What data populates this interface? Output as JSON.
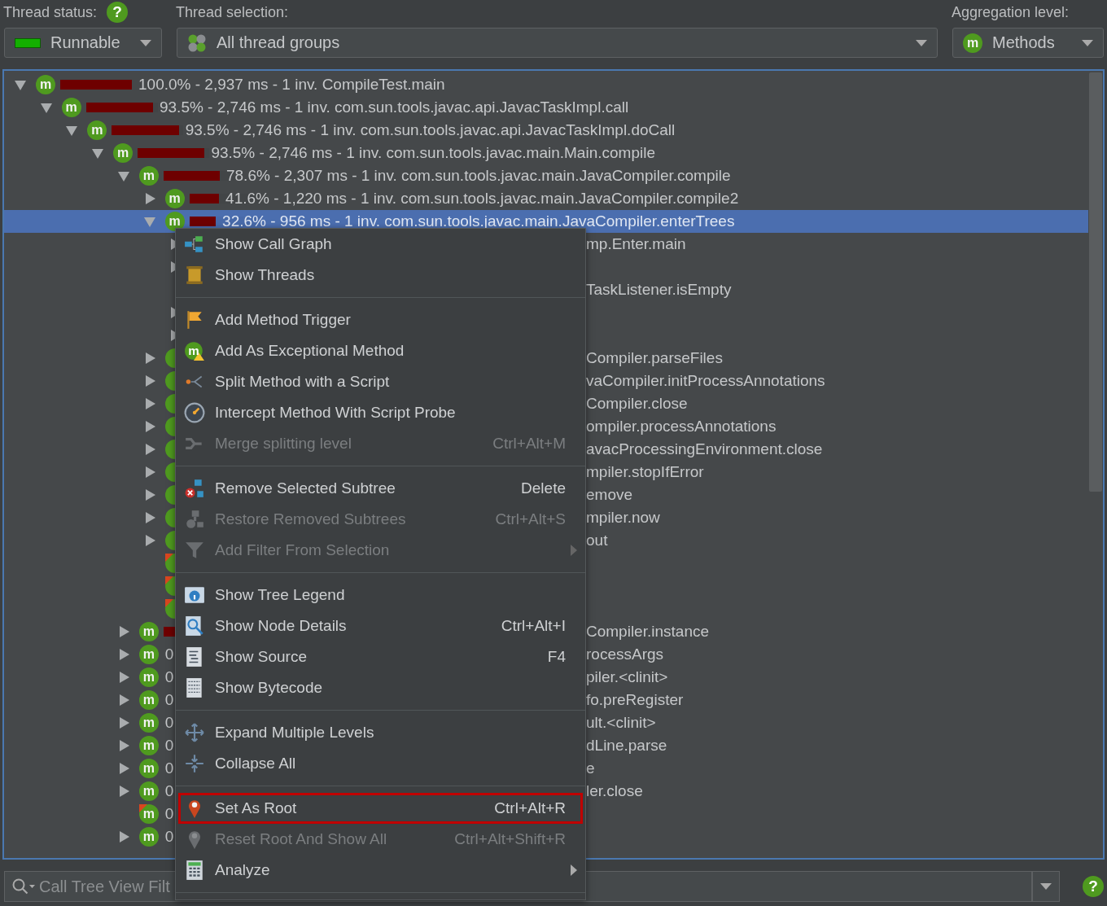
{
  "thread_status": {
    "label": "Thread status:",
    "help": "?",
    "value": "Runnable"
  },
  "thread_selection": {
    "label": "Thread selection:",
    "value": "All thread groups"
  },
  "aggregation_level": {
    "label": "Aggregation level:",
    "value": "Methods",
    "icon": "m"
  },
  "call_tree": [
    {
      "kind": "node",
      "expanded": true,
      "selected": false,
      "icon": "m",
      "level": 1.0,
      "label": "100.0% - 2,937 ms - 1 inv. CompileTest.main",
      "children": [
        {
          "kind": "node",
          "expanded": true,
          "selected": false,
          "icon": "m",
          "level": 0.935,
          "label": "93.5% - 2,746 ms - 1 inv. com.sun.tools.javac.api.JavacTaskImpl.call",
          "children": [
            {
              "kind": "node",
              "expanded": true,
              "selected": false,
              "icon": "m",
              "level": 0.935,
              "label": "93.5% - 2,746 ms - 1 inv. com.sun.tools.javac.api.JavacTaskImpl.doCall",
              "children": [
                {
                  "kind": "node",
                  "expanded": true,
                  "selected": false,
                  "icon": "m",
                  "level": 0.935,
                  "label": "93.5% - 2,746 ms - 1 inv. com.sun.tools.javac.main.Main.compile",
                  "children": [
                    {
                      "kind": "node",
                      "expanded": true,
                      "selected": false,
                      "icon": "m",
                      "level": 0.786,
                      "label": "78.6% - 2,307 ms - 1 inv. com.sun.tools.javac.main.JavaCompiler.compile",
                      "children": [
                        {
                          "kind": "node",
                          "expanded": false,
                          "selected": false,
                          "icon": "m",
                          "level": 0.416,
                          "label": "41.6% - 1,220 ms - 1 inv. com.sun.tools.javac.main.JavaCompiler.compile2"
                        },
                        {
                          "kind": "node",
                          "expanded": true,
                          "selected": true,
                          "icon": "m",
                          "level": 0.37,
                          "label": "32.6% - 956 ms - 1 inv. com.sun.tools.javac.main.JavaCompiler.enterTrees",
                          "children": [
                            {
                              "kind": "node",
                              "expanded": false,
                              "selected": false,
                              "tail": "mp.Enter.main"
                            },
                            {
                              "kind": "node",
                              "expanded": false,
                              "selected": false
                            },
                            {
                              "kind": "leaf",
                              "selected": false,
                              "tail": "TaskListener.isEmpty"
                            },
                            {
                              "kind": "node",
                              "expanded": false,
                              "selected": false
                            },
                            {
                              "kind": "node",
                              "expanded": false,
                              "selected": false
                            }
                          ]
                        },
                        {
                          "kind": "node",
                          "expanded": false,
                          "selected": false,
                          "method_icon": true,
                          "tail": "Compiler.parseFiles"
                        },
                        {
                          "kind": "node",
                          "expanded": false,
                          "selected": false,
                          "method_icon": true,
                          "tail": "vaCompiler.initProcessAnnotations"
                        },
                        {
                          "kind": "node",
                          "expanded": false,
                          "selected": false,
                          "method_icon": true,
                          "tail": "Compiler.close"
                        },
                        {
                          "kind": "node",
                          "expanded": false,
                          "selected": false,
                          "method_icon": true,
                          "tail": "ompiler.processAnnotations"
                        },
                        {
                          "kind": "node",
                          "expanded": false,
                          "selected": false,
                          "method_icon": true,
                          "tail": "avacProcessingEnvironment.close"
                        },
                        {
                          "kind": "node",
                          "expanded": false,
                          "selected": false,
                          "method_icon": true,
                          "tail": "mpiler.stopIfError"
                        },
                        {
                          "kind": "node",
                          "expanded": false,
                          "selected": false,
                          "method_icon": true,
                          "tail": "emove"
                        },
                        {
                          "kind": "node",
                          "expanded": false,
                          "selected": false,
                          "method_icon": true,
                          "tail": "mpiler.now"
                        },
                        {
                          "kind": "node",
                          "expanded": false,
                          "selected": false,
                          "method_icon": true,
                          "tail": "out"
                        },
                        {
                          "kind": "leaf",
                          "selected": false,
                          "method_icon": true,
                          "flagged": true
                        },
                        {
                          "kind": "leaf",
                          "selected": false,
                          "method_icon": true,
                          "flagged": true
                        },
                        {
                          "kind": "leaf",
                          "selected": false,
                          "method_icon": true,
                          "flagged": true
                        }
                      ]
                    },
                    {
                      "kind": "node",
                      "expanded": false,
                      "selected": false,
                      "icon": "m",
                      "level": 0.2,
                      "tail": "Compiler.instance"
                    },
                    {
                      "kind": "node",
                      "expanded": false,
                      "selected": false,
                      "icon": "m",
                      "head": "0",
                      "tail": "rocessArgs"
                    },
                    {
                      "kind": "node",
                      "expanded": false,
                      "selected": false,
                      "icon": "m",
                      "head": "0",
                      "tail": "piler.<clinit>"
                    },
                    {
                      "kind": "node",
                      "expanded": false,
                      "selected": false,
                      "icon": "m",
                      "head": "0",
                      "tail": "fo.preRegister"
                    },
                    {
                      "kind": "node",
                      "expanded": false,
                      "selected": false,
                      "icon": "m",
                      "head": "0",
                      "tail": "ult.<clinit>"
                    },
                    {
                      "kind": "node",
                      "expanded": false,
                      "selected": false,
                      "icon": "m",
                      "head": "0",
                      "tail": "dLine.parse"
                    },
                    {
                      "kind": "node",
                      "expanded": false,
                      "selected": false,
                      "icon": "m",
                      "head": "0",
                      "tail": "e"
                    },
                    {
                      "kind": "node",
                      "expanded": false,
                      "selected": false,
                      "icon": "m",
                      "head": "0",
                      "tail": "ler.close"
                    },
                    {
                      "kind": "leaf",
                      "selected": false,
                      "icon": "m",
                      "flagged": true,
                      "head": "0"
                    },
                    {
                      "kind": "node",
                      "expanded": false,
                      "selected": false,
                      "icon": "m",
                      "head": "0"
                    }
                  ]
                }
              ]
            }
          ]
        }
      ]
    }
  ],
  "context_menu": {
    "groups": [
      {
        "items": [
          {
            "kind": "graph",
            "label": "Show Call Graph",
            "disabled": false,
            "selected": false
          },
          {
            "kind": "threads",
            "label": "Show Threads",
            "disabled": false,
            "selected": false
          }
        ]
      },
      {
        "items": [
          {
            "kind": "flag",
            "label": "Add Method Trigger",
            "disabled": false,
            "selected": false
          },
          {
            "kind": "method",
            "badge": "m",
            "label": "Add As Exceptional Method",
            "disabled": false,
            "selected": false
          },
          {
            "kind": "split",
            "label": "Split Method with a Script",
            "disabled": false,
            "selected": false
          },
          {
            "kind": "gauge",
            "label": "Intercept Method With Script Probe",
            "disabled": false,
            "selected": false
          },
          {
            "kind": "merge",
            "label": "Merge splitting level",
            "shortcut": "Ctrl+Alt+M",
            "disabled": true,
            "selected": false
          }
        ]
      },
      {
        "items": [
          {
            "kind": "remove",
            "label": "Remove Selected Subtree",
            "shortcut": "Delete",
            "disabled": false,
            "selected": false
          },
          {
            "kind": "restore",
            "label": "Restore Removed Subtrees",
            "shortcut": "Ctrl+Alt+S",
            "disabled": true,
            "selected": false
          },
          {
            "kind": "filter",
            "label": "Add Filter From Selection",
            "submenu": true,
            "disabled": true,
            "selected": false
          }
        ]
      },
      {
        "items": [
          {
            "kind": "legend",
            "label": "Show Tree Legend",
            "disabled": false,
            "selected": false
          },
          {
            "kind": "details",
            "label": "Show Node Details",
            "shortcut": "Ctrl+Alt+I",
            "disabled": false,
            "selected": false
          },
          {
            "kind": "source",
            "label": "Show Source",
            "shortcut": "F4",
            "disabled": false,
            "selected": false
          },
          {
            "kind": "bytecode",
            "label": "Show Bytecode",
            "disabled": false,
            "selected": false
          }
        ]
      },
      {
        "items": [
          {
            "kind": "expand",
            "label": "Expand Multiple Levels",
            "disabled": false,
            "selected": false
          },
          {
            "kind": "collapse",
            "label": "Collapse All",
            "disabled": false,
            "selected": false
          }
        ]
      },
      {
        "items": [
          {
            "kind": "pin",
            "label": "Set As Root",
            "shortcut": "Ctrl+Alt+R",
            "disabled": false,
            "selected": true
          },
          {
            "kind": "reset",
            "label": "Reset Root And Show All",
            "shortcut": "Ctrl+Alt+Shift+R",
            "disabled": true,
            "selected": false
          },
          {
            "kind": "calc",
            "label": "Analyze",
            "submenu": true,
            "disabled": false,
            "selected": false
          }
        ]
      }
    ]
  },
  "filter": {
    "placeholder": "Call Tree View Filt",
    "help": "?"
  }
}
